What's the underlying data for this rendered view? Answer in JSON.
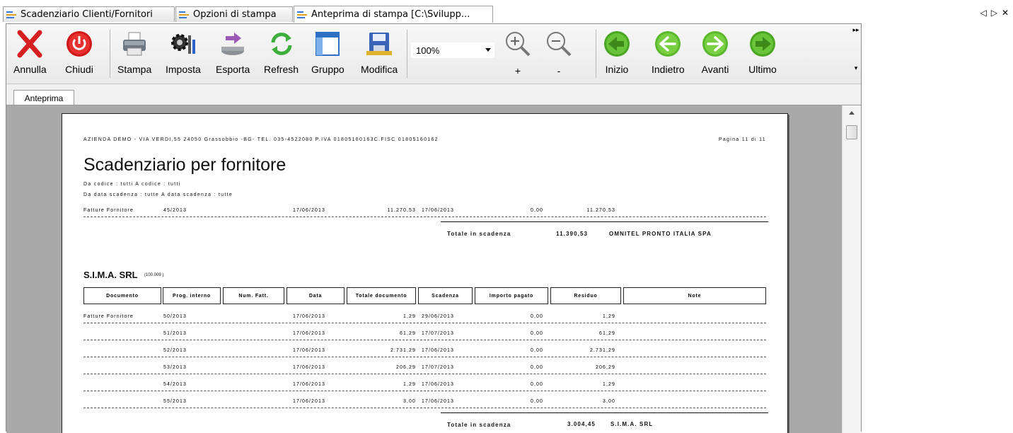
{
  "tabs": [
    {
      "label": "Scadenziario Clienti/Fornitori"
    },
    {
      "label": "Opzioni di stampa"
    },
    {
      "label": "Anteprima di stampa [C:\\Svilupp..."
    }
  ],
  "tab_nav": {
    "prev": "◁",
    "next": "▷",
    "close": "✕"
  },
  "toolbar": {
    "annulla": "Annulla",
    "chiudi": "Chiudi",
    "stampa": "Stampa",
    "imposta": "Imposta",
    "esporta": "Esporta",
    "refresh": "Refresh",
    "gruppo": "Gruppo",
    "modifica": "Modifica",
    "zoom_value": "100%",
    "zoom_in": "+",
    "zoom_out": "-",
    "inizio": "Inizio",
    "indietro": "Indietro",
    "avanti": "Avanti",
    "ultimo": "Ultimo",
    "grip_top": "▸▸",
    "grip_bottom": "▾"
  },
  "preview_tab": "Anteprima",
  "report": {
    "header_line": "AZIENDA DEMO - VIA VERDI,55 24050 Grassobbio -BG- TEL. 035-4522080 P.IVA 01805160163C.FISC 01805160162",
    "page": "Pagina 11 di 11",
    "title": "Scadenziario per fornitore",
    "filter1": "Da codice : tutti A codice : tutti",
    "filter2": "Da data scadenza : tutte  A data scadenza : tutte",
    "prev_row": {
      "doc": "Fatture Fornitore",
      "prog": "45/2013",
      "data": "17/06/2013",
      "totale": "11.270,53",
      "scadenza": "17/06/2013",
      "pagato": "0,00",
      "residuo": "11.270,53"
    },
    "total1": {
      "label": "Totale in scadenza",
      "amount": "11.390,53",
      "name": "OMNITEL PRONTO ITALIA SPA"
    },
    "supplier": {
      "name": "S.I.M.A. SRL",
      "code": "(100.009 )"
    },
    "columns": [
      "Documento",
      "Prog. interno",
      "Num. Fatt.",
      "Data",
      "Totale documento",
      "Scadenza",
      "Importo pagato",
      "Residuo",
      "Note"
    ],
    "rows": [
      {
        "doc": "Fatture Fornitore",
        "prog": "50/2013",
        "data": "17/06/2013",
        "totale": "1,29",
        "scadenza": "29/06/2013",
        "pagato": "0,00",
        "residuo": "1,29"
      },
      {
        "doc": "",
        "prog": "51/2013",
        "data": "17/06/2013",
        "totale": "61,29",
        "scadenza": "17/07/2013",
        "pagato": "0,00",
        "residuo": "61,29"
      },
      {
        "doc": "",
        "prog": "52/2013",
        "data": "17/06/2013",
        "totale": "2.731,29",
        "scadenza": "17/06/2013",
        "pagato": "0,00",
        "residuo": "2.731,29"
      },
      {
        "doc": "",
        "prog": "53/2013",
        "data": "17/06/2013",
        "totale": "206,29",
        "scadenza": "17/07/2013",
        "pagato": "0,00",
        "residuo": "206,29"
      },
      {
        "doc": "",
        "prog": "54/2013",
        "data": "17/06/2013",
        "totale": "1,29",
        "scadenza": "17/06/2013",
        "pagato": "0,00",
        "residuo": "1,29"
      },
      {
        "doc": "",
        "prog": "55/2013",
        "data": "17/06/2013",
        "totale": "3,00",
        "scadenza": "17/06/2013",
        "pagato": "0,00",
        "residuo": "3,00"
      }
    ],
    "total2": {
      "label": "Totale in scadenza",
      "amount": "3.004,45",
      "name": "S.I.M.A. SRL"
    }
  }
}
